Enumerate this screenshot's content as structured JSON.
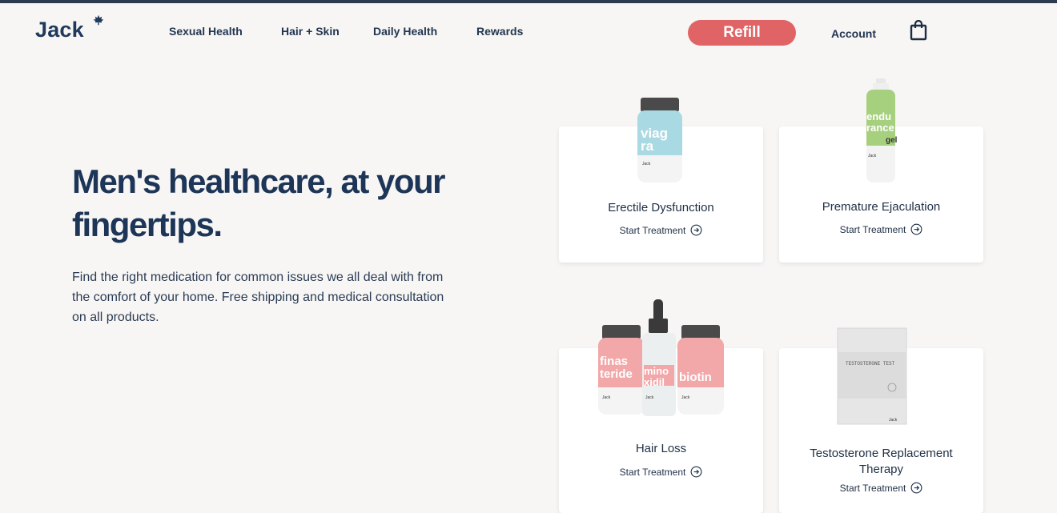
{
  "header": {
    "logo": "Jack",
    "nav": [
      "Sexual Health",
      "Hair + Skin",
      "Daily Health",
      "Rewards"
    ],
    "refill_label": "Refill",
    "account_label": "Account"
  },
  "hero": {
    "title_line1": "Men's healthcare, at your",
    "title_line2": "fingertips.",
    "description": "Find the right medication for common issues we all deal with from the comfort of your home. Free shipping and medical consultation on all products."
  },
  "cards": [
    {
      "title": "Erectile Dysfunction",
      "cta": "Start Treatment"
    },
    {
      "title": "Premature Ejaculation",
      "cta": "Start Treatment"
    },
    {
      "title": "Hair Loss",
      "cta": "Start Treatment"
    },
    {
      "title": "Testosterone Replacement Therapy",
      "cta": "Start Treatment"
    }
  ],
  "products": {
    "viagra": {
      "line1": "viag",
      "line2": "ra",
      "brand": "Jack"
    },
    "endurance": {
      "line1": "endu",
      "line2": "rance",
      "line3": "gel",
      "brand": "Jack"
    },
    "finasteride": {
      "line1": "finas",
      "line2": "teride",
      "brand": "Jack"
    },
    "minoxidil": {
      "line1": "mino",
      "line2": "xidil",
      "brand": "Jack"
    },
    "biotin": {
      "line1": "biotin",
      "brand": "Jack"
    },
    "testosterone": {
      "label": "TESTOSTERONE TEST",
      "brand": "Jack"
    }
  },
  "colors": {
    "navy": "#1d3557",
    "refill": "#e06466",
    "viagra_blue": "#a9d9e2",
    "endurance_green": "#a6cf7e",
    "pink": "#f2a7a9"
  },
  "icons": {
    "leaf": "maple-leaf-icon",
    "cart": "shopping-bag-icon",
    "cta": "arrow-right-circle-icon"
  }
}
